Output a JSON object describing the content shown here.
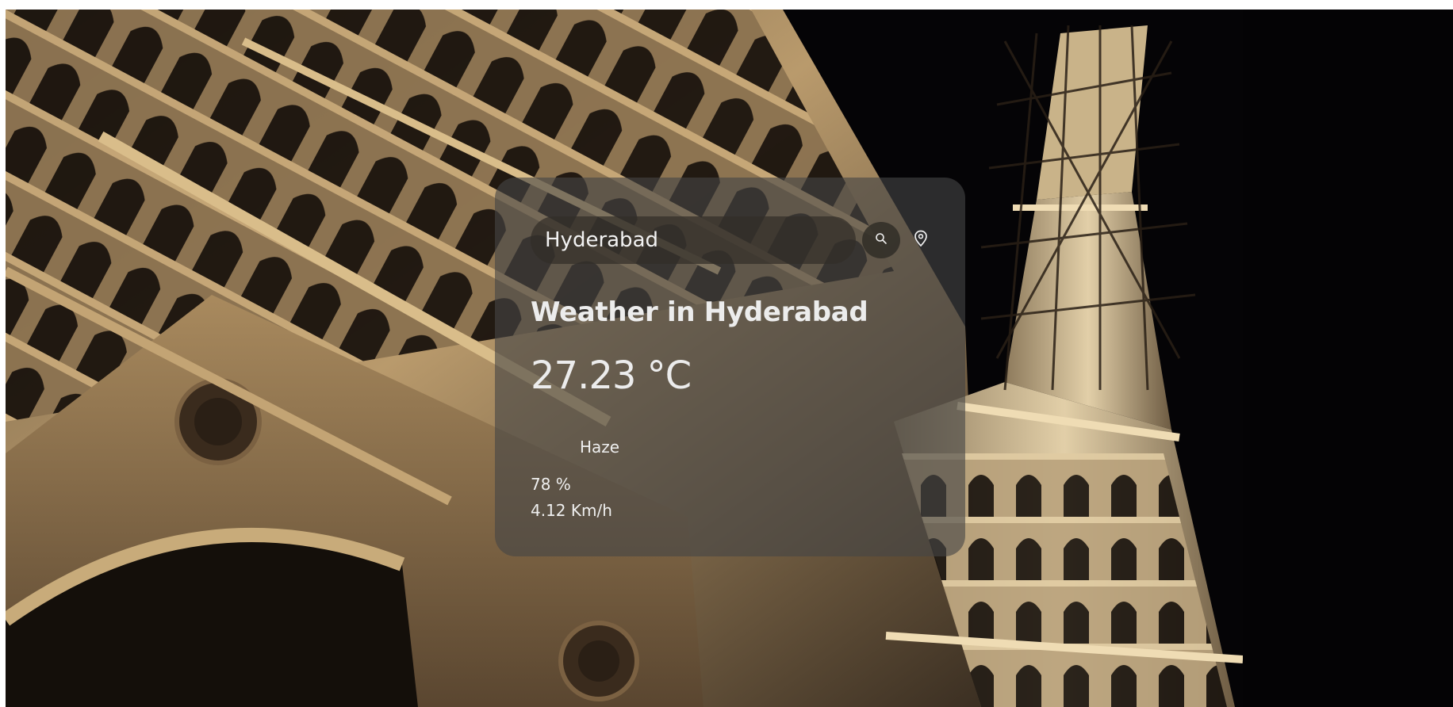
{
  "search": {
    "value": "Hyderabad",
    "search_icon": "search-icon",
    "location_icon": "map-pin-icon"
  },
  "weather": {
    "title": "Weather in Hyderabad",
    "temperature": "27.23 °C",
    "description": "Haze",
    "humidity": "78 %",
    "wind": "4.12 Km/h"
  },
  "colors": {
    "card": "#464646",
    "text": "#ececec",
    "stone": "#b89766",
    "night_sky": "#050406"
  }
}
